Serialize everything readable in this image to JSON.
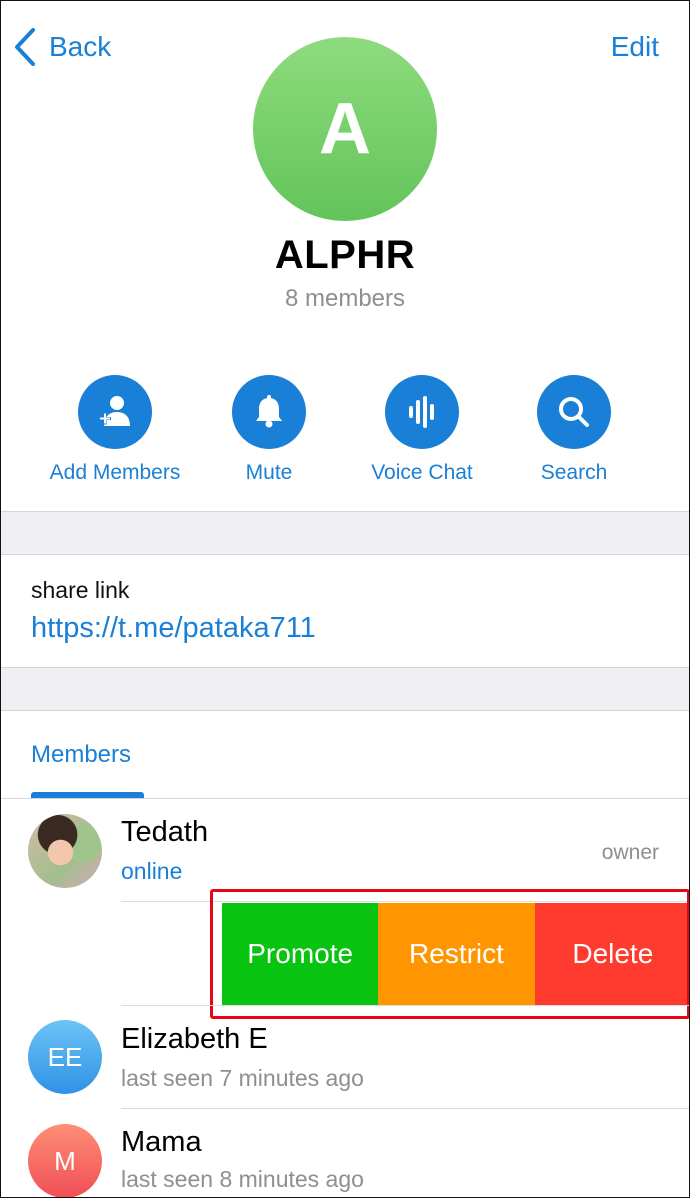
{
  "header": {
    "back_label": "Back",
    "edit_label": "Edit"
  },
  "group": {
    "initial": "A",
    "name": "ALPHR",
    "members_count": "8 members",
    "avatar_color": "#63c45b"
  },
  "actions": [
    {
      "label": "Add Members",
      "icon": "add-member-icon"
    },
    {
      "label": "Mute",
      "icon": "bell-icon"
    },
    {
      "label": "Voice Chat",
      "icon": "voice-chat-icon"
    },
    {
      "label": "Search",
      "icon": "search-icon"
    }
  ],
  "share": {
    "title": "share link",
    "link": "https://t.me/pataka711"
  },
  "members_tab": {
    "label": "Members"
  },
  "members": [
    {
      "name": "Tedath",
      "status": "online",
      "role": "owner",
      "avatar": "photo"
    },
    {
      "name": "Elizabeth E",
      "status": "last seen 7 minutes ago",
      "initials": "EE",
      "avatar_color": "#3aa0ee"
    },
    {
      "name": "Mama",
      "status": "last seen 8 minutes ago",
      "initials": "M",
      "avatar_color": "#f2615b"
    }
  ],
  "swipe_actions": {
    "promote": "Promote",
    "restrict": "Restrict",
    "delete": "Delete"
  },
  "colors": {
    "accent": "#1a7fd6",
    "promote": "#08c310",
    "restrict": "#ff9500",
    "delete": "#ff3b2f",
    "highlight": "#e30613"
  }
}
